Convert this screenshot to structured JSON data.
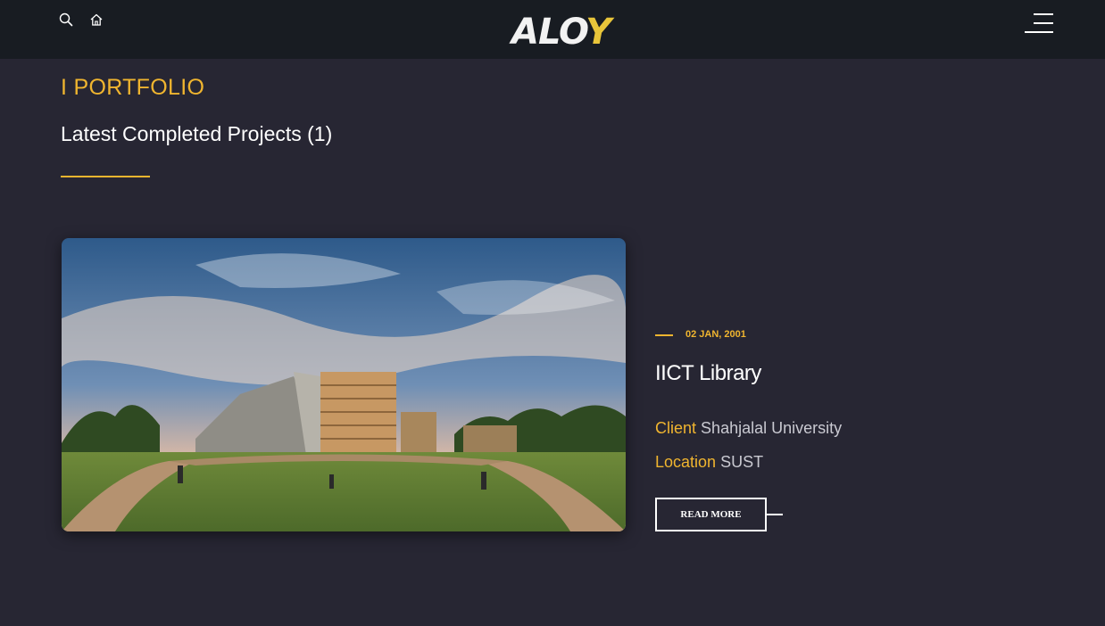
{
  "header": {
    "logo_main": "ALO",
    "logo_accent": "Y",
    "icons": [
      "search-icon",
      "home-icon",
      "menu-icon"
    ]
  },
  "section": {
    "label": "I PORTFOLIO",
    "title": "Latest Completed Projects (1)"
  },
  "project": {
    "date": "02 JAN, 2001",
    "title": "IICT Library",
    "client_label": "Client",
    "client_value": "Shahjalal University",
    "location_label": "Location",
    "location_value": "SUST",
    "button_label": "READ MORE"
  },
  "colors": {
    "accent": "#f0b52f",
    "background": "#272633",
    "header": "#181c22"
  }
}
